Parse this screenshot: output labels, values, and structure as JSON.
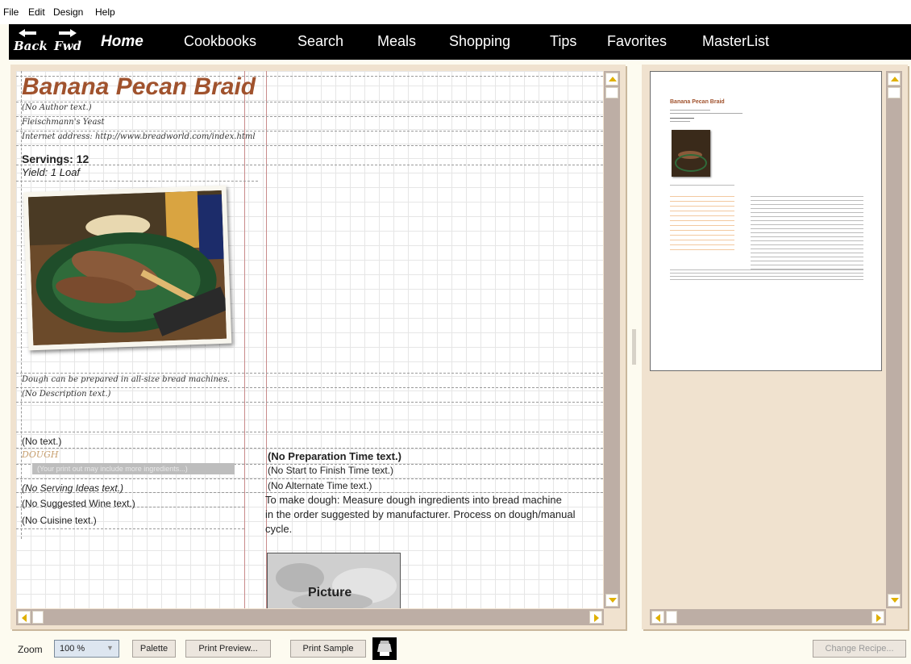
{
  "menu": [
    "File",
    "Edit",
    "Design",
    "Help"
  ],
  "nav": {
    "back_label": "Back",
    "fwd_label": "Fwd",
    "links": [
      "Home",
      "Cookbooks",
      "Search",
      "Meals",
      "Shopping",
      "Tips",
      "Favorites",
      "MasterList"
    ]
  },
  "recipe": {
    "title": "Banana Pecan Braid",
    "author": "(No Author text.)",
    "source": "Fleischmann's Yeast",
    "internet": "Internet address: http://www.breadworld.com/index.html",
    "servings": "Servings: 12",
    "yield": "Yield: 1 Loaf",
    "note": "Dough can be prepared in all-size bread machines.",
    "description": "(No Description text.)",
    "no_text": "(No  text.)",
    "section": "DOUGH",
    "ingredient_hint": "(Your print out may include more ingredients...)",
    "serving_ideas": "(No Serving Ideas text.)",
    "wine": "(No Suggested Wine text.)",
    "cuisine": "(No Cuisine text.)",
    "prep_time": "(No Preparation Time text.)",
    "start_finish": "(No Start to Finish Time text.)",
    "alt_time": "(No Alternate Time text.)",
    "instructions_1": "To make dough: Measure dough ingredients into bread machine",
    "instructions_2": "in the order suggested by manufacturer. Process on dough/manual",
    "instructions_3": "cycle.",
    "picture_label": "Picture"
  },
  "preview": {
    "title": "Banana Pecan Braid"
  },
  "bottom": {
    "zoom_label": "Zoom",
    "zoom_value": "100 %",
    "palette": "Palette",
    "print_preview": "Print Preview...",
    "print_sample": "Print Sample",
    "change_recipe": "Change Recipe..."
  },
  "colors": {
    "title_brown": "#a0522d",
    "nav_bg": "#000000",
    "frame": "#f0e2cf",
    "scroll": "#bdaea5"
  }
}
